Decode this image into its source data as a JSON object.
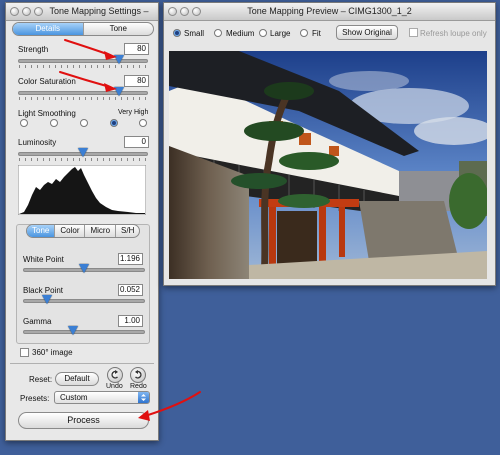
{
  "settings_window": {
    "title": "Tone Mapping Settings – CIMG…",
    "tabs": [
      {
        "label": "Details Enhancer",
        "selected": true
      },
      {
        "label": "Tone Compressor",
        "selected": false
      }
    ],
    "strength": {
      "label": "Strength",
      "value": "80",
      "level": 0.8
    },
    "color_saturation": {
      "label": "Color Saturation",
      "value": "80",
      "level": 0.8
    },
    "light_smoothing": {
      "label": "Light Smoothing",
      "high_label": "Very High",
      "selected_index": 4,
      "options": 5
    },
    "luminosity": {
      "label": "Luminosity",
      "value": "0",
      "level": 0.5
    },
    "sub_tabs": [
      {
        "label": "Tone",
        "selected": true
      },
      {
        "label": "Color",
        "selected": false
      },
      {
        "label": "Micro",
        "selected": false
      },
      {
        "label": "S/H",
        "selected": false
      }
    ],
    "white_point": {
      "label": "White Point",
      "value": "1.196",
      "level": 0.5
    },
    "black_point": {
      "label": "Black Point",
      "value": "0.052",
      "level": 0.2
    },
    "gamma": {
      "label": "Gamma",
      "value": "1.00",
      "level": 0.4
    },
    "image_360": {
      "label": "360° image",
      "checked": false
    },
    "reset": {
      "label": "Reset:",
      "default_button": "Default",
      "undo": "Undo",
      "redo": "Redo"
    },
    "presets": {
      "label": "Presets:",
      "value": "Custom"
    },
    "process_button": "Process"
  },
  "preview_window": {
    "title": "Tone Mapping Preview – CIMG1300_1_2",
    "sizes": [
      {
        "label": "Small",
        "selected": true
      },
      {
        "label": "Medium",
        "selected": false
      },
      {
        "label": "Large",
        "selected": false
      },
      {
        "label": "Fit",
        "selected": false
      }
    ],
    "show_original": "Show Original",
    "refresh_loupe": {
      "label": "Refresh loupe only",
      "checked": false
    }
  },
  "colors": {
    "desktop": "#3f5f9a",
    "accent": "#3b7fd4",
    "annotation_arrow": "#e01010"
  }
}
